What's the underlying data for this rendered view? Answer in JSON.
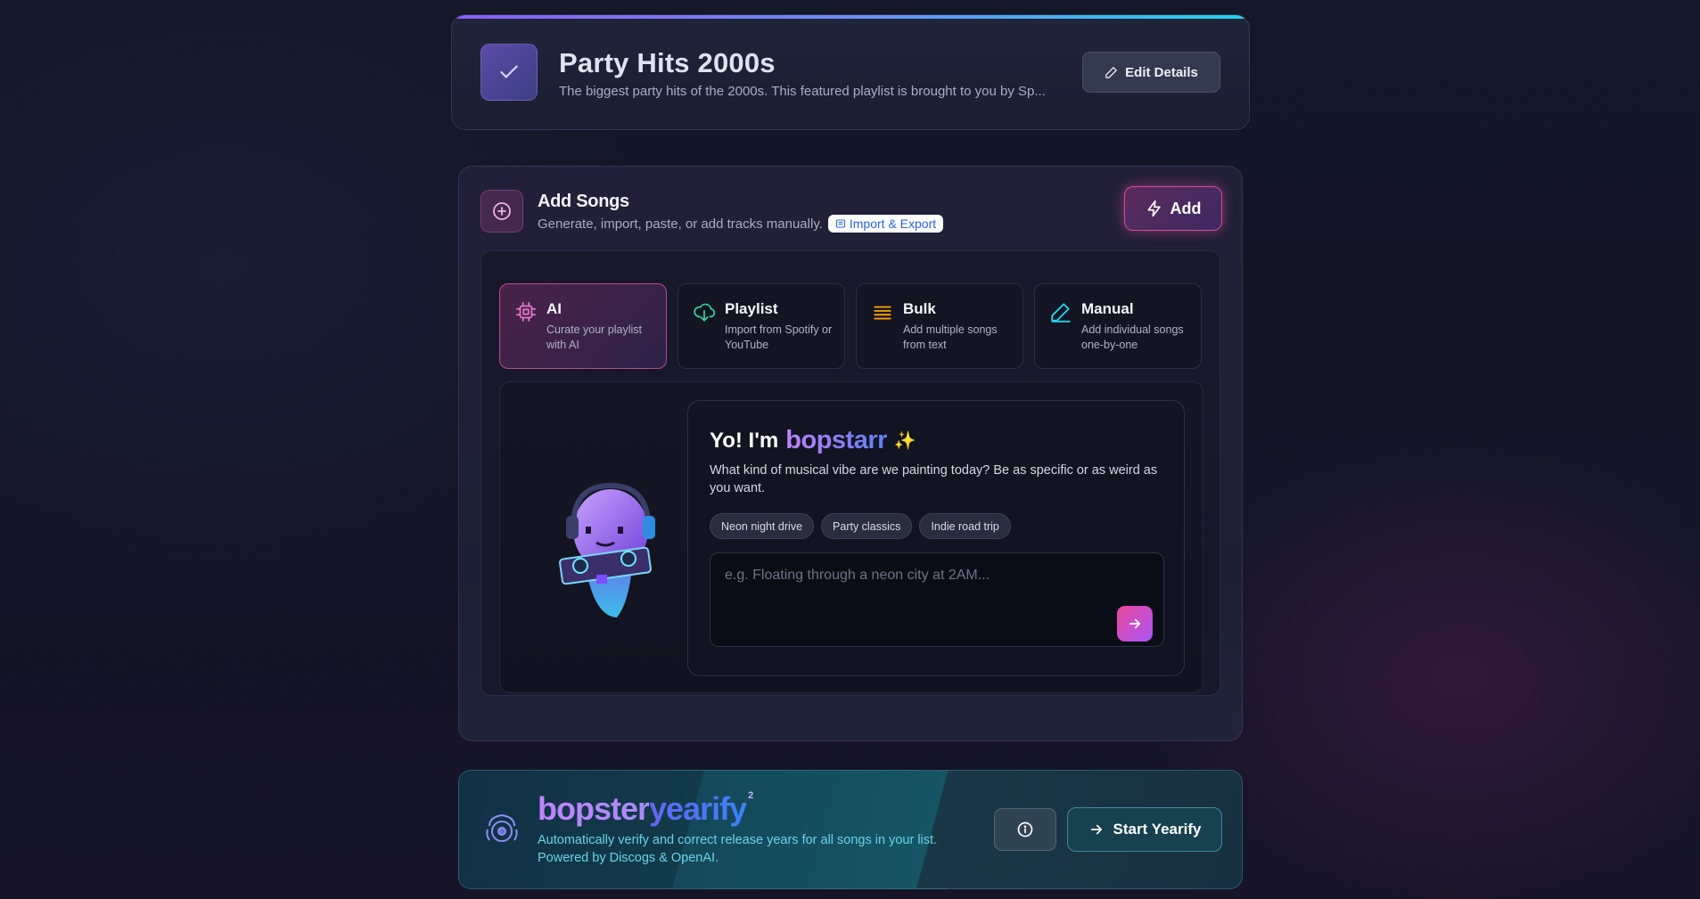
{
  "header": {
    "title": "Party Hits 2000s",
    "description": "The biggest party hits of the 2000s. This featured playlist is brought to you by Sp...",
    "edit_label": "Edit Details"
  },
  "add_songs": {
    "title": "Add Songs",
    "subtitle": "Generate, import, paste, or add tracks manually.",
    "import_label": "Import & Export",
    "add_label": "Add",
    "modes": [
      {
        "title": "AI",
        "desc": "Curate your playlist with AI",
        "icon": "chip-icon",
        "color": "#e879c9"
      },
      {
        "title": "Playlist",
        "desc": "Import from Spotify or YouTube",
        "icon": "cloud-download-icon",
        "color": "#34d399"
      },
      {
        "title": "Bulk",
        "desc": "Add multiple songs from text",
        "icon": "list-icon",
        "color": "#f59e0b"
      },
      {
        "title": "Manual",
        "desc": "Add individual songs one-by-one",
        "icon": "pen-icon",
        "color": "#22d3ee"
      }
    ],
    "ai": {
      "greeting": "Yo! I'm",
      "brand": "bopstarr",
      "sparkle": "✨",
      "prompt_text": "What kind of musical vibe are we painting today? Be as specific or as weird as you want.",
      "chips": [
        "Neon night drive",
        "Party classics",
        "Indie road trip"
      ],
      "placeholder": "e.g. Floating through a neon city at 2AM..."
    }
  },
  "yearify": {
    "brand_part1": "bopster",
    "brand_part2": "yearify",
    "superscript": "2",
    "desc_line1": "Automatically verify and correct release years for all songs in your list.",
    "desc_line2": "Powered by Discogs & OpenAI.",
    "start_label": "Start Yearify"
  },
  "colors": {
    "accent_pink": "#d6499b",
    "accent_purple": "#8b5cf6",
    "accent_cyan": "#22d3ee"
  }
}
